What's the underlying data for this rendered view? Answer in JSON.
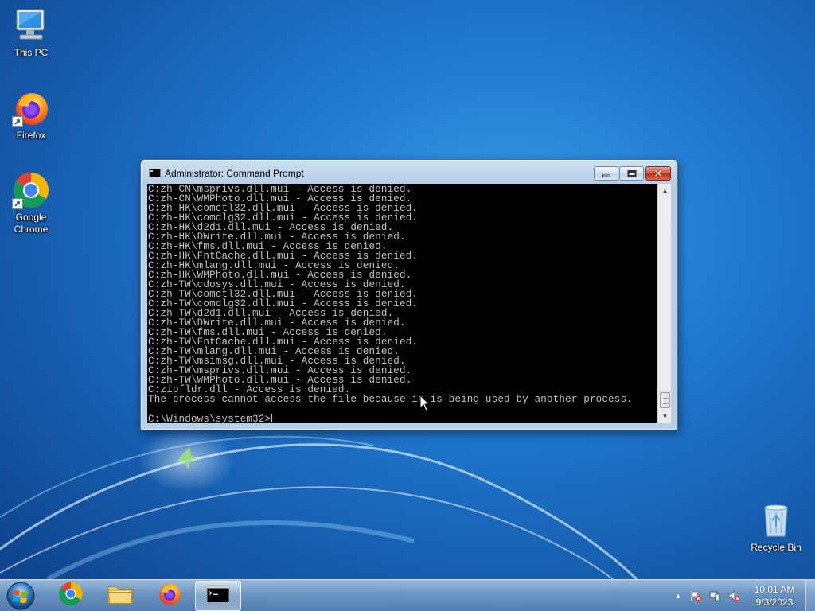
{
  "desktop": {
    "icons": [
      {
        "label": "This PC",
        "icon": "computer-icon"
      },
      {
        "label": "Firefox",
        "icon": "firefox-icon"
      },
      {
        "label": "Google Chrome",
        "icon": "chrome-icon"
      },
      {
        "label": "Recycle Bin",
        "icon": "recycle-bin-icon"
      }
    ]
  },
  "window": {
    "title": "Administrator:  Command Prompt",
    "buttons": {
      "minimize": "minimize",
      "maximize": "maximize",
      "close": "close"
    },
    "close_glyph": "✕",
    "console_lines": [
      "C:zh-CN\\msprivs.dll.mui - Access is denied.",
      "C:zh-CN\\WMPhoto.dll.mui - Access is denied.",
      "C:zh-HK\\comctl32.dll.mui - Access is denied.",
      "C:zh-HK\\comdlg32.dll.mui - Access is denied.",
      "C:zh-HK\\d2d1.dll.mui - Access is denied.",
      "C:zh-HK\\DWrite.dll.mui - Access is denied.",
      "C:zh-HK\\fms.dll.mui - Access is denied.",
      "C:zh-HK\\FntCache.dll.mui - Access is denied.",
      "C:zh-HK\\mlang.dll.mui - Access is denied.",
      "C:zh-HK\\WMPhoto.dll.mui - Access is denied.",
      "C:zh-TW\\cdosys.dll.mui - Access is denied.",
      "C:zh-TW\\comctl32.dll.mui - Access is denied.",
      "C:zh-TW\\comdlg32.dll.mui - Access is denied.",
      "C:zh-TW\\d2d1.dll.mui - Access is denied.",
      "C:zh-TW\\DWrite.dll.mui - Access is denied.",
      "C:zh-TW\\fms.dll.mui - Access is denied.",
      "C:zh-TW\\FntCache.dll.mui - Access is denied.",
      "C:zh-TW\\mlang.dll.mui - Access is denied.",
      "C:zh-TW\\msimsg.dll.mui - Access is denied.",
      "C:zh-TW\\msprivs.dll.mui - Access is denied.",
      "C:zh-TW\\WMPhoto.dll.mui - Access is denied.",
      "C:zipfldr.dll - Access is denied.",
      "The process cannot access the file because it is being used by another process.",
      "",
      "C:\\Windows\\system32>"
    ]
  },
  "taskbar": {
    "start": "start-orb-icon",
    "pinned": [
      {
        "name": "chrome",
        "icon": "chrome-icon"
      },
      {
        "name": "file-explorer",
        "icon": "folder-icon"
      },
      {
        "name": "firefox",
        "icon": "firefox-icon"
      },
      {
        "name": "command-prompt",
        "icon": "cmd-icon",
        "active": true
      }
    ],
    "tray_arrow": "▲",
    "clock": {
      "time": "10:01 AM",
      "date": "9/3/2023"
    }
  },
  "colors": {
    "console_bg": "#000000",
    "console_fg": "#c0c0c0",
    "close_red": "#c12b14"
  }
}
